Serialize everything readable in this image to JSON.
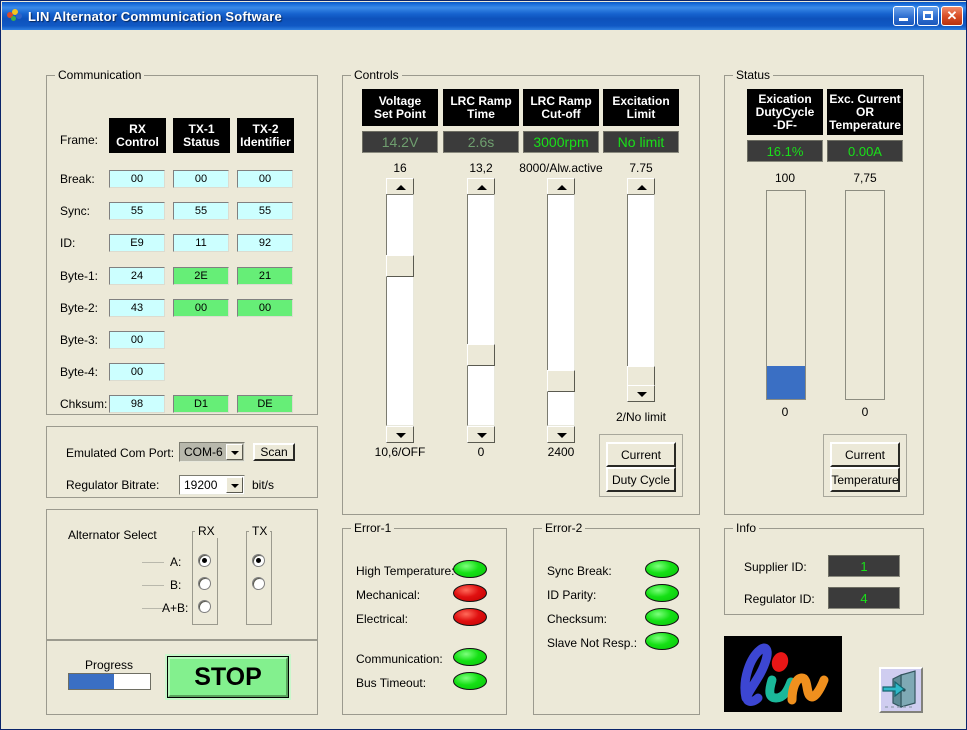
{
  "window": {
    "title": "LIN Alternator Communication Software",
    "icon": "lin-app-icon",
    "buttons": {
      "minimize": "minimize-button",
      "maximize": "maximize-button",
      "close": "close-button",
      "close_glyph": "✕"
    }
  },
  "communication": {
    "title": "Communication",
    "frame_label": "Frame:",
    "columns": [
      {
        "line1": "RX",
        "line2": "Control"
      },
      {
        "line1": "TX-1",
        "line2": "Status"
      },
      {
        "line1": "TX-2",
        "line2": "Identifier"
      }
    ],
    "rows": [
      {
        "label": "Break:",
        "cells": [
          {
            "v": "00",
            "hl": false
          },
          {
            "v": "00",
            "hl": false
          },
          {
            "v": "00",
            "hl": false
          }
        ]
      },
      {
        "label": "Sync:",
        "cells": [
          {
            "v": "55",
            "hl": false
          },
          {
            "v": "55",
            "hl": false
          },
          {
            "v": "55",
            "hl": false
          }
        ]
      },
      {
        "label": "ID:",
        "cells": [
          {
            "v": "E9",
            "hl": false
          },
          {
            "v": "11",
            "hl": false
          },
          {
            "v": "92",
            "hl": false
          }
        ]
      },
      {
        "label": "Byte-1:",
        "cells": [
          {
            "v": "24",
            "hl": false
          },
          {
            "v": "2E",
            "hl": true
          },
          {
            "v": "21",
            "hl": true
          }
        ]
      },
      {
        "label": "Byte-2:",
        "cells": [
          {
            "v": "43",
            "hl": false
          },
          {
            "v": "00",
            "hl": true
          },
          {
            "v": "00",
            "hl": true
          }
        ]
      },
      {
        "label": "Byte-3:",
        "cells": [
          {
            "v": "00",
            "hl": false
          },
          null,
          null
        ]
      },
      {
        "label": "Byte-4:",
        "cells": [
          {
            "v": "00",
            "hl": false
          },
          null,
          null
        ]
      },
      {
        "label": "Chksum:",
        "cells": [
          {
            "v": "98",
            "hl": false
          },
          {
            "v": "D1",
            "hl": true
          },
          {
            "v": "DE",
            "hl": true
          }
        ]
      }
    ],
    "com_port_label": "Emulated Com Port:",
    "com_port_value": "COM-6",
    "scan_button": "Scan",
    "bitrate_label": "Regulator Bitrate:",
    "bitrate_value": "19200",
    "bitrate_unit": "bit/s",
    "alternator_select": "Alternator Select",
    "alt_rows": [
      "A:",
      "B:",
      "A+B:"
    ],
    "rx_group": "RX",
    "tx_group": "TX",
    "rx_selected": 0,
    "tx_selected": 0,
    "progress_label": "Progress",
    "progress_percent": 56,
    "stop_button": "STOP"
  },
  "controls": {
    "title": "Controls",
    "items": [
      {
        "cap1": "Voltage",
        "cap2": "Set Point",
        "value": "14.2V",
        "dim": true,
        "top_label": "16",
        "bottom_label": "10,6/OFF",
        "thumb_pct": 37
      },
      {
        "cap1": "LRC Ramp",
        "cap2": "Time",
        "value": "2.6s",
        "dim": true,
        "top_label": "13,2",
        "bottom_label": "0",
        "thumb_pct": 73
      },
      {
        "cap1": "LRC Ramp",
        "cap2": "Cut-off",
        "value": "3000rpm",
        "dim": false,
        "top_label": "8000/Alw.active",
        "bottom_label": "2400",
        "thumb_pct": 66
      },
      {
        "cap1": "Excitation",
        "cap2": "Limit",
        "value": "No limit",
        "dim": false,
        "top_label": "7.75",
        "bottom_label": "2/No limit",
        "thumb_pct": 85
      }
    ],
    "mode_buttons": [
      "Current",
      "Duty Cycle"
    ]
  },
  "status": {
    "title": "Status",
    "gauges": [
      {
        "cap1": "Exication",
        "cap2": "DutyCycle",
        "cap3": "-DF-",
        "value": "16.1%",
        "top_label": "100",
        "bottom_label": "0",
        "fill_percent": 16
      },
      {
        "cap1": "Exc. Current",
        "cap2": "OR",
        "cap3": "Temperature",
        "value": "0.00A",
        "top_label": "7,75",
        "bottom_label": "0",
        "fill_percent": 0
      }
    ],
    "mode_buttons": [
      "Current",
      "Temperature"
    ]
  },
  "error1": {
    "title": "Error-1",
    "items": [
      {
        "label": "High Temperature:",
        "state": "green"
      },
      {
        "label": "Mechanical:",
        "state": "red"
      },
      {
        "label": "Electrical:",
        "state": "red"
      },
      {
        "label": "Communication:",
        "state": "green"
      },
      {
        "label": "Bus Timeout:",
        "state": "green"
      }
    ]
  },
  "error2": {
    "title": "Error-2",
    "items": [
      {
        "label": "Sync Break:",
        "state": "green"
      },
      {
        "label": "ID Parity:",
        "state": "green"
      },
      {
        "label": "Checksum:",
        "state": "green"
      },
      {
        "label": "Slave Not Resp.:",
        "state": "green"
      }
    ]
  },
  "info": {
    "title": "Info",
    "supplier_label": "Supplier ID:",
    "supplier_value": "1",
    "regulator_label": "Regulator ID:",
    "regulator_value": "4",
    "logo_text": "lin",
    "exit_icon": "exit-door-icon"
  },
  "colors": {
    "window_bg": "#ECE9D8",
    "lcd_bg": "#3b3b3b",
    "lcd_fg": "#19e019",
    "lcd_fg_dim": "#6f9f6f",
    "hex_bg": "#ccffff",
    "hex_bg_highlight": "#66ee77",
    "led_green": "#15e015",
    "led_red": "#e01010",
    "progress_fill": "#3a6fc4",
    "stop_bg": "#83f08e",
    "title_blue": "#1663cf"
  }
}
